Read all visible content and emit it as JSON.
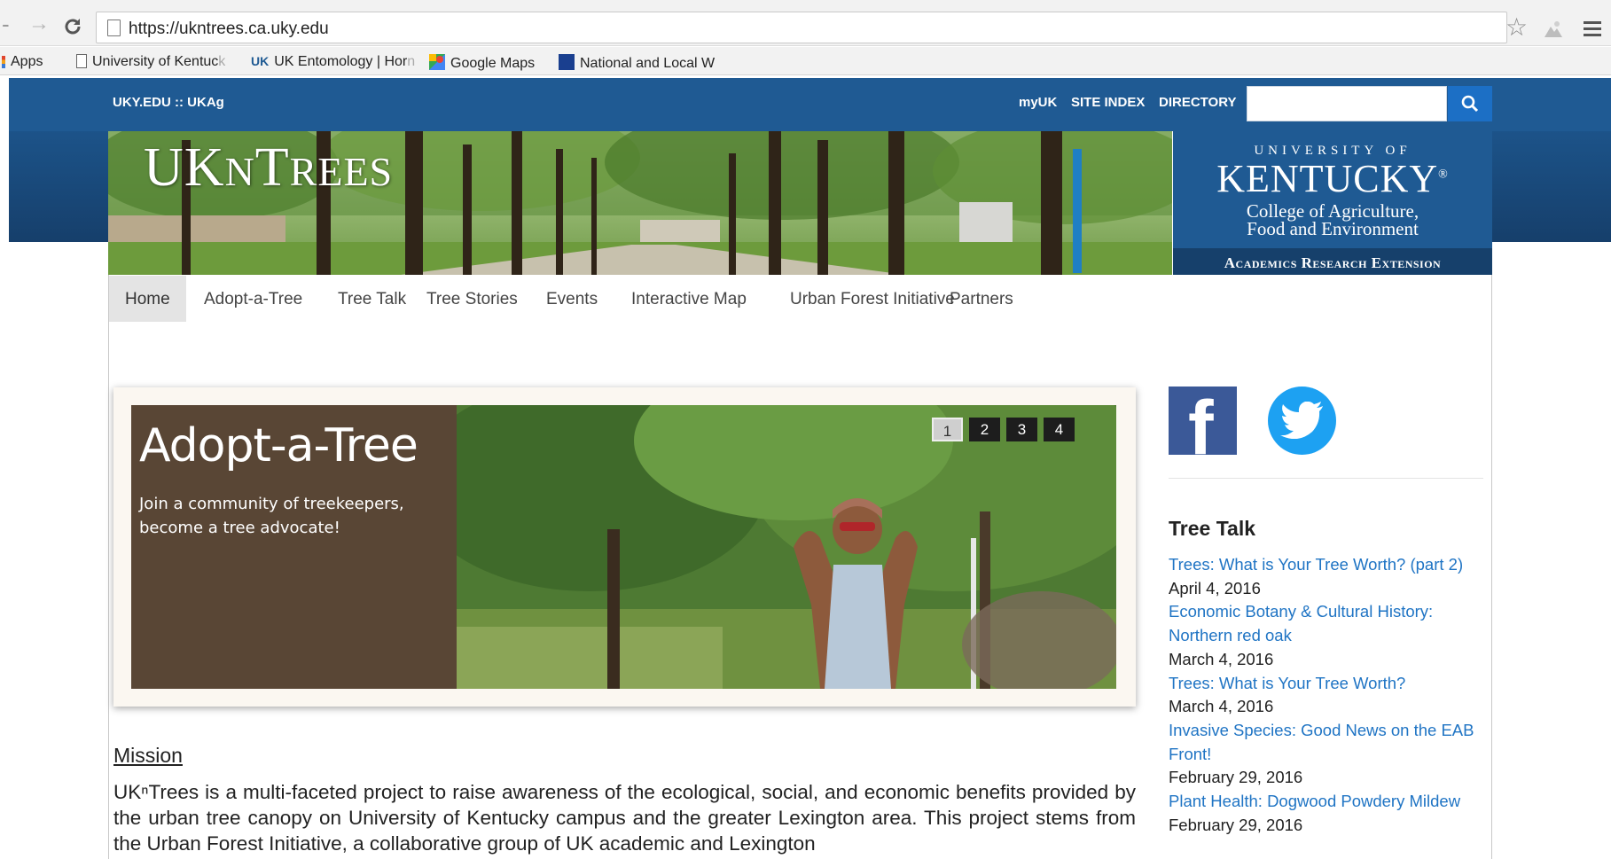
{
  "browser": {
    "url": "https://ukntrees.ca.uky.edu",
    "bookmarks": [
      {
        "label": "Apps",
        "fade": ""
      },
      {
        "label": "University of Kentuc",
        "fade": "k"
      },
      {
        "label": "UK Entomology | Hor",
        "fade": "n"
      },
      {
        "label": "Google Maps",
        "fade": ""
      },
      {
        "label": "National and Local W",
        "fade": ""
      }
    ],
    "bookmark_icon_text": "UK"
  },
  "site": {
    "top_left": "UKY.EDU :: UKAg",
    "top_links": [
      "myUK",
      "SITE INDEX",
      "DIRECTORY"
    ],
    "search_placeholder": ""
  },
  "banner": {
    "title_a": "UK",
    "title_b": "N",
    "title_c": "T",
    "title_d": "REES",
    "uk_small": "UNIVERSITY OF",
    "uk_big": "KENTUCKY",
    "uk_reg": "®",
    "uk_sub_1": "College of Agriculture,",
    "uk_sub_2": "Food and Environment",
    "uk_bar": "Academics Research Extension"
  },
  "nav": [
    "Home",
    "Adopt-a-Tree",
    "Tree Talk",
    "Tree Stories",
    "Events",
    "Interactive Map",
    "Urban Forest Initiative",
    "Partners"
  ],
  "slider": {
    "title": "Adopt-a-Tree",
    "text": "Join a community of treekeepers, become a tree advocate!",
    "pages": [
      "1",
      "2",
      "3",
      "4"
    ],
    "active_page": "1"
  },
  "article": {
    "heading": "Mission",
    "body": "UKⁿTrees is a multi-faceted project to raise awareness of the ecological, social, and economic benefits provided by the urban tree canopy on University of Kentucky campus and the greater Lexington area. This project stems from the Urban Forest Initiative, a collaborative group of UK academic and Lexington"
  },
  "sidebar": {
    "heading": "Tree Talk",
    "posts": [
      {
        "title": "Trees: What is Your Tree Worth? (part 2)",
        "date": "April 4, 2016"
      },
      {
        "title": "Economic Botany & Cultural History: Northern red oak",
        "date": "March 4, 2016"
      },
      {
        "title": "Trees: What is Your Tree Worth?",
        "date": "March 4, 2016"
      },
      {
        "title": "Invasive Species: Good News on the EAB Front!",
        "date": "February 29, 2016"
      },
      {
        "title": "Plant Health: Dogwood Powdery Mildew",
        "date": "February 29, 2016"
      }
    ]
  },
  "colors": {
    "uk_blue": "#1f5a93",
    "link_blue": "#1f74c4",
    "caption_brown": "#594635",
    "facebook": "#3b5998",
    "twitter": "#1da1f2"
  }
}
